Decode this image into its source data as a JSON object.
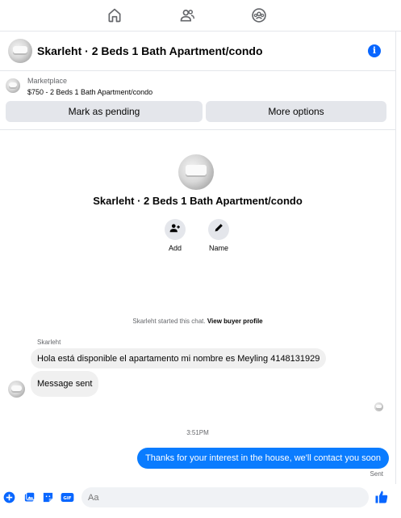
{
  "nav": {
    "icons": [
      "home-icon",
      "people-icon",
      "community-icon"
    ]
  },
  "header": {
    "title": "Skarleht · 2 Beds 1 Bath Apartment/condo",
    "info_icon": "info-icon"
  },
  "marketplace": {
    "label": "Marketplace",
    "listing": "$750 - 2 Beds 1 Bath Apartment/condo",
    "mark_pending": "Mark as pending",
    "more_options": "More options"
  },
  "intro": {
    "title": "Skarleht · 2 Beds 1 Bath Apartment/condo",
    "add_label": "Add",
    "name_label": "Name"
  },
  "chat": {
    "system_text": "Skarleht started this chat.",
    "system_link": "View buyer profile",
    "sender": "Skarleht",
    "messages_in": [
      "Hola está disponible el apartamento mi nombre es Meyling 4148131929",
      "Message sent"
    ],
    "timestamp": "3:51PM",
    "message_out": "Thanks for your interest in the house, we'll contact you soon",
    "status": "Sent"
  },
  "composer": {
    "placeholder": "Aa"
  },
  "colors": {
    "accent": "#0866ff",
    "outgoing_bubble": "#0a7cff",
    "incoming_bubble": "#f0f0f0",
    "button_bg": "#e4e6eb"
  }
}
